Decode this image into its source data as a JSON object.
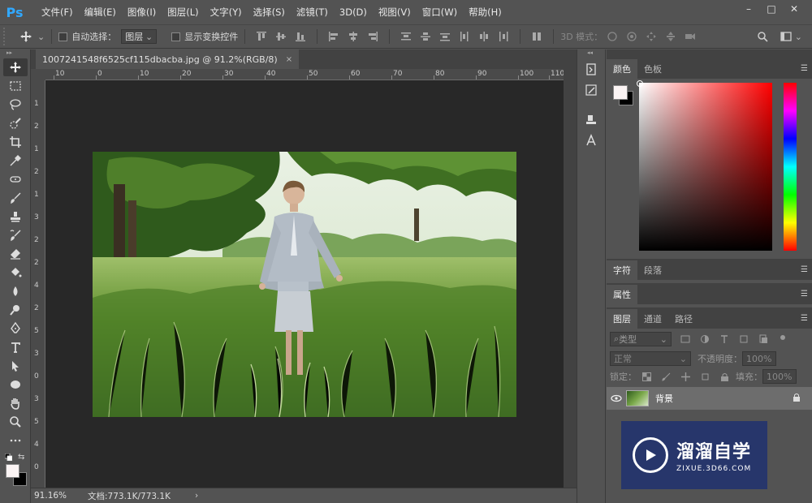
{
  "app": {
    "logo": "Ps"
  },
  "menu": [
    "文件(F)",
    "编辑(E)",
    "图像(I)",
    "图层(L)",
    "文字(Y)",
    "选择(S)",
    "滤镜(T)",
    "3D(D)",
    "视图(V)",
    "窗口(W)",
    "帮助(H)"
  ],
  "window_controls": {
    "minimize": "–",
    "maximize": "□",
    "close": "✕"
  },
  "options": {
    "auto_select_label": "自动选择：",
    "auto_select_value": "图层",
    "show_transform_label": "显示变换控件",
    "mode_3d_label": "3D 模式："
  },
  "document": {
    "tab_title": "1007241548f6525cf115dbacba.jpg @ 91.2%(RGB/8)",
    "close": "×",
    "ruler_h_labels": [
      "10",
      "0",
      "10",
      "20",
      "30",
      "40",
      "50",
      "60",
      "70",
      "80",
      "90",
      "100",
      "110"
    ],
    "ruler_v_labels": [
      "1",
      "2",
      "1",
      "2",
      "1",
      "3",
      "2",
      "2",
      "4",
      "2",
      "5",
      "3",
      "0",
      "3",
      "5",
      "4",
      "0"
    ]
  },
  "status": {
    "zoom": "91.16%",
    "doc_info": "文档:773.1K/773.1K",
    "arrow": "›"
  },
  "panels": {
    "color_tabs": [
      "颜色",
      "色板"
    ],
    "char_tabs": [
      "字符",
      "段落"
    ],
    "properties_tab": "属性",
    "layers_tabs": [
      "图层",
      "通道",
      "路径"
    ],
    "filter_kind": "类型",
    "blend_mode": "正常",
    "opacity_label": "不透明度：",
    "opacity_value": "100%",
    "lock_label": "锁定：",
    "fill_label": "填充：",
    "fill_value": "100%",
    "layer_name": "背景"
  },
  "watermark": {
    "title": "溜溜自学",
    "url": "ZIXUE.3D66.COM"
  },
  "colors": {
    "fg": "#fbf4f4",
    "bg": "#000000",
    "accent": "#31a8ff"
  }
}
